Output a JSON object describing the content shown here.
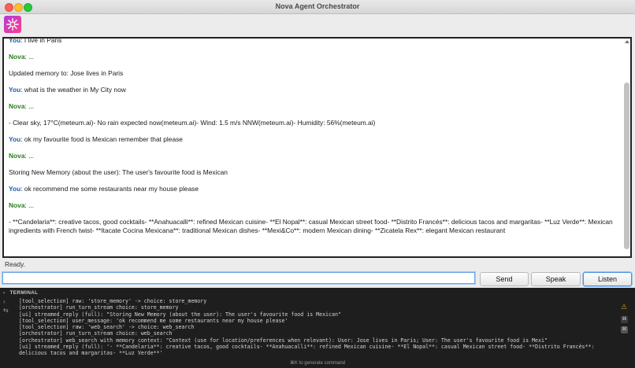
{
  "window": {
    "title": "Nova Agent Orchestrator"
  },
  "colors": {
    "you": "#1f5fa8",
    "nova": "#2a7d1f",
    "logo": "#c23ad0"
  },
  "chat": {
    "messages": [
      {
        "speaker": "You",
        "text": "I live in Paris"
      },
      {
        "speaker": "Nova",
        "text": "..."
      },
      {
        "speaker": "",
        "text": "Updated memory to: Jose lives in Paris"
      },
      {
        "speaker": "You",
        "text": "what is the weather in My City now"
      },
      {
        "speaker": "Nova",
        "text": "..."
      },
      {
        "speaker": "",
        "text": "- Clear sky, 17°C(meteum.ai)- No rain expected now(meteum.ai)- Wind: 1.5 m/s NNW(meteum.ai)- Humidity: 56%(meteum.ai)"
      },
      {
        "speaker": "You",
        "text": "ok my favourite food is Mexican remember that please"
      },
      {
        "speaker": "Nova",
        "text": "..."
      },
      {
        "speaker": "",
        "text": "Storing New Memory (about the user): The user's favourite food is Mexican"
      },
      {
        "speaker": "You",
        "text": "ok recommend me some restaurants near my house please"
      },
      {
        "speaker": "Nova",
        "text": "..."
      },
      {
        "speaker": "",
        "text": "- **Candelaria**: creative tacos, good cocktails- **Anahuacalli**: refined Mexican cuisine- **El Nopal**: casual Mexican street food- **Distrito Francés**: delicious tacos and margaritas- **Luz Verde**: Mexican ingredients with French twist- **Itacate Cocina Mexicana**: traditional Mexican dishes- **Mexi&Co**: modern Mexican dining- **Zicatela Rex**: elegant Mexican restaurant"
      }
    ]
  },
  "status": "Ready.",
  "input": {
    "value": "",
    "placeholder": ""
  },
  "buttons": {
    "send": "Send",
    "speak": "Speak",
    "listen": "Listen"
  },
  "terminal": {
    "header": "TERMINAL",
    "lines": [
      "[tool_selection] raw: 'store_memory' -> choice: store_memory",
      "[orchestrator] run_turn_stream choice: store_memory",
      "[ui] streamed_reply (full): \"Storing New Memory (about the user): The user's favourite food is Mexican\"",
      "[tool_selection] user_message: 'ok recommend me some restaurants near my house please'",
      "[tool_selection] raw: 'web_search' -> choice: web_search",
      "[orchestrator] run_turn_stream choice: web_search",
      "[orchestrator] web_search with memory context: \"Context (use for location/preferences when relevant): User: Jose lives in Paris; User: The user's favourite food is Mexi\"",
      "[ui] streamed_reply (full): '- **Candelaria**: creative tacos, good cocktails- **Anahuacalli**: refined Mexican cuisine- **El Nopal**: casual Mexican street food- **Distrito Francés**: delicious tacos and margaritas- **Luz Verde**'"
    ],
    "hint": "⌘K to generate command"
  }
}
